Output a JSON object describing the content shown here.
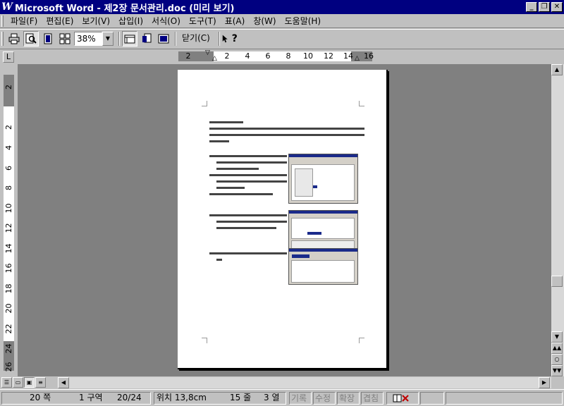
{
  "window": {
    "title": "Microsoft Word - 제2장 문서관리.doc (미리 보기)",
    "app_icon": "W",
    "buttons": [
      "minimize",
      "restore",
      "close"
    ]
  },
  "menubar": {
    "items": [
      "파일(F)",
      "편집(E)",
      "보기(V)",
      "삽입(I)",
      "서식(O)",
      "도구(T)",
      "표(A)",
      "창(W)",
      "도움말(H)"
    ]
  },
  "toolbar": {
    "zoom_value": "38%",
    "close_label": "닫기(C)",
    "help_label": "?"
  },
  "ruler": {
    "h_ticks": [
      "2",
      "2",
      "4",
      "6",
      "8",
      "10",
      "12",
      "14",
      "16"
    ],
    "v_ticks": [
      "2",
      "2",
      "4",
      "6",
      "8",
      "10",
      "12",
      "14",
      "16",
      "18",
      "20",
      "22",
      "24",
      "26"
    ],
    "corner_symbol": "L"
  },
  "statusbar": {
    "page": "20 쪽",
    "section": "1 구역",
    "page_count": "20/24",
    "position": "위치 13,8cm",
    "line": "15 줄",
    "column": "3 열",
    "rec": "기록",
    "trk": "수정",
    "ext": "확장",
    "ovr": "겹침"
  },
  "colors": {
    "titlebar": "#000080",
    "chrome": "#c0c0c0",
    "workspace": "#808080"
  }
}
